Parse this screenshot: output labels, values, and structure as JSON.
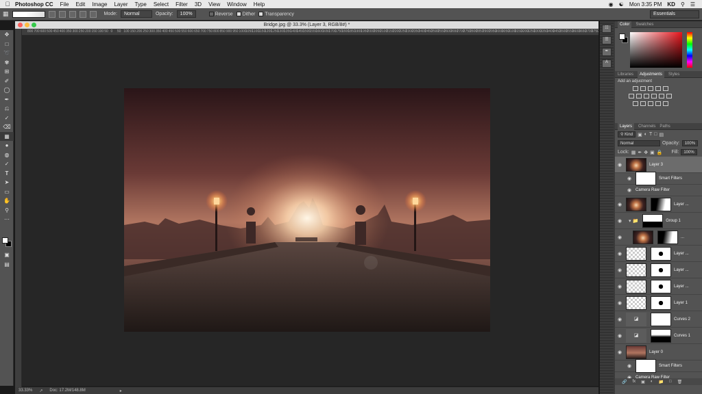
{
  "menubar": {
    "app": "Photoshop CC",
    "items": [
      "File",
      "Edit",
      "Image",
      "Layer",
      "Type",
      "Select",
      "Filter",
      "3D",
      "View",
      "Window",
      "Help"
    ],
    "clock": "Mon 3:35 PM",
    "user": "KD"
  },
  "options": {
    "mode_label": "Mode:",
    "mode_value": "Normal",
    "opacity_label": "Opacity:",
    "opacity_value": "100%",
    "reverse_label": "Reverse",
    "dither_label": "Dither",
    "transparency_label": "Transparency",
    "workspace": "Essentials"
  },
  "document": {
    "title": "Bridge.jpg @ 33.3% (Layer 3, RGB/8#) *",
    "zoom": "33.33%",
    "doc_info": "Doc: 17.2M/148.8M",
    "ruler_ticks": [
      "800",
      "700",
      "600",
      "500",
      "450",
      "400",
      "350",
      "300",
      "250",
      "200",
      "150",
      "100",
      "50",
      "0",
      "50",
      "100",
      "150",
      "200",
      "250",
      "300",
      "350",
      "400",
      "450",
      "500",
      "550",
      "600",
      "650",
      "700",
      "750",
      "800",
      "850",
      "900",
      "950",
      "1000",
      "1050",
      "1100",
      "1150",
      "1200",
      "1250",
      "1300",
      "1350",
      "1400",
      "1450",
      "1500",
      "1550",
      "1600",
      "1650",
      "1700",
      "1750",
      "1800",
      "1850",
      "1900",
      "1950",
      "2000",
      "2050",
      "2100",
      "2150",
      "2200",
      "2250",
      "2300",
      "2350",
      "2400",
      "2450",
      "2500",
      "2550",
      "2600",
      "2650",
      "2700",
      "2750",
      "2800",
      "2850",
      "2900",
      "2950",
      "3000",
      "3050",
      "3100",
      "3150",
      "3200",
      "3250",
      "3300",
      "3350",
      "3400",
      "3450",
      "3500",
      "3550",
      "3600",
      "3650",
      "3700",
      "3750",
      "3800",
      "3850"
    ]
  },
  "panels": {
    "color_tabs": [
      "Color",
      "Swatches"
    ],
    "adj_tabs": [
      "Libraries",
      "Adjustments",
      "Styles"
    ],
    "adj_header": "Add an adjustment",
    "layers_tabs": [
      "Layers",
      "Channels",
      "Paths"
    ],
    "kind_filter": "Kind",
    "blend_mode": "Normal",
    "opacity_label": "Opacity:",
    "opacity_value": "100%",
    "lock_label": "Lock:",
    "fill_label": "Fill:",
    "fill_value": "100%",
    "layers": [
      {
        "name": "Layer 3",
        "thumb": "glow",
        "selected": true
      },
      {
        "name": "Smart Filters",
        "sub": true
      },
      {
        "name": "Camera Raw Filter",
        "sub2": true
      },
      {
        "name": "Layer ...",
        "thumb": "glow",
        "mask": true
      },
      {
        "name": "Group 1",
        "group": true
      },
      {
        "name": "...",
        "thumb": "glow",
        "mask": true,
        "indent": true
      },
      {
        "name": "Layer ...",
        "thumb": "checker",
        "mask": true
      },
      {
        "name": "Layer ...",
        "thumb": "checker",
        "mask": true
      },
      {
        "name": "Layer ...",
        "thumb": "checker",
        "mask": true
      },
      {
        "name": "Layer 1",
        "thumb": "checker",
        "mask": true
      },
      {
        "name": "Curves 2",
        "thumb": "adj",
        "mask": true
      },
      {
        "name": "Curves 1",
        "thumb": "adj",
        "mask": true
      },
      {
        "name": "Layer 0",
        "thumb": "photo"
      },
      {
        "name": "Smart Filters",
        "sub": true
      },
      {
        "name": "Camera Raw Filter",
        "sub2": true
      }
    ]
  }
}
